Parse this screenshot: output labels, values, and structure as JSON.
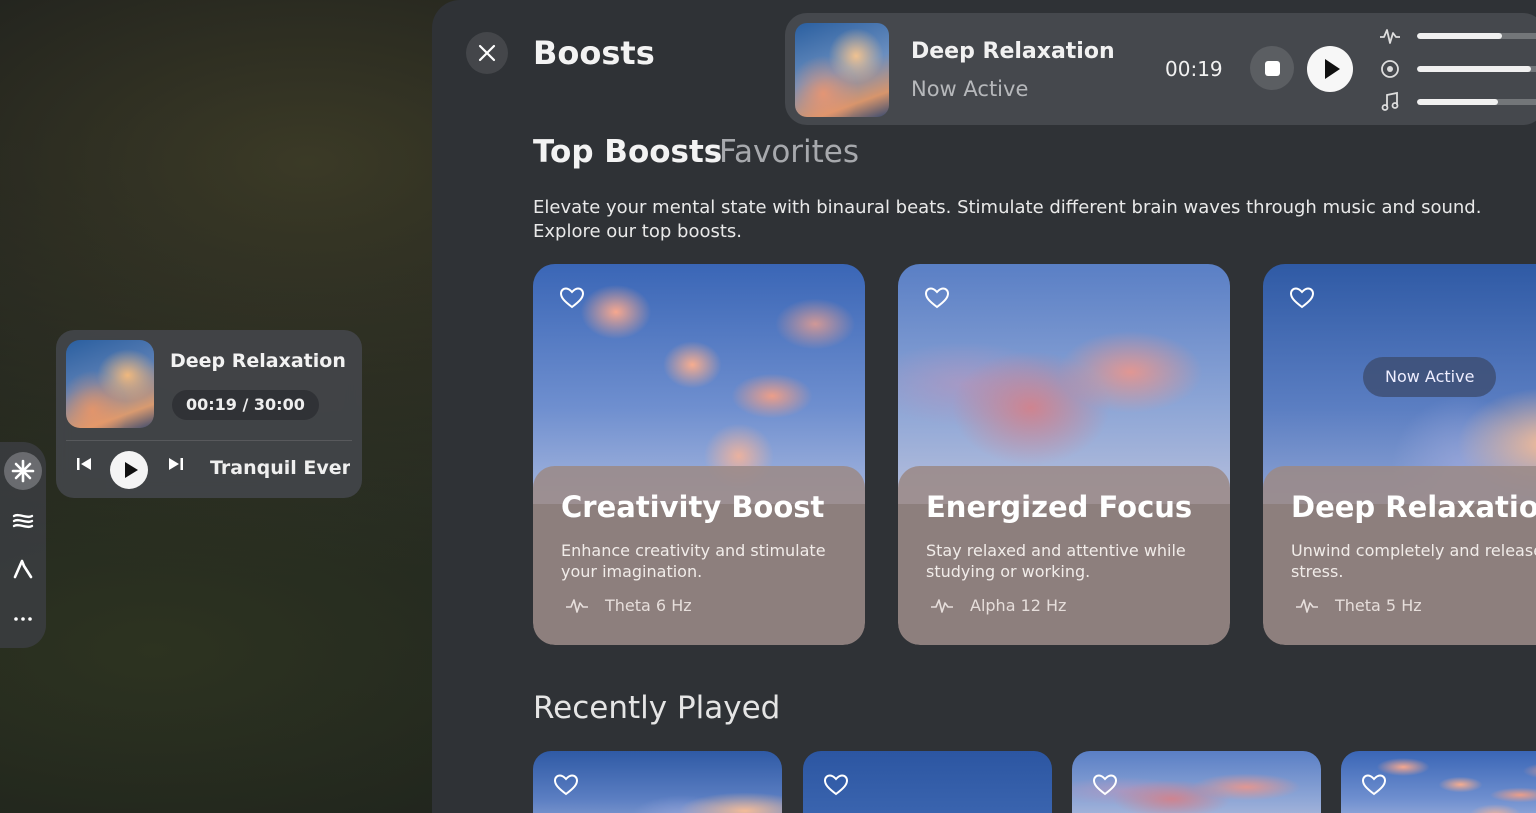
{
  "mini_player": {
    "title": "Deep Relaxation",
    "time": "00:19 / 30:00",
    "next_track": "Tranquil Evenin"
  },
  "toolbar": {
    "icons": [
      "asterisk-icon",
      "waves-icon",
      "compass-icon",
      "more-icon"
    ]
  },
  "header": {
    "title": "Boosts"
  },
  "now_playing": {
    "title": "Deep Relaxation",
    "status": "Now Active",
    "elapsed": "00:19",
    "mixer_levels": [
      0.65,
      0.88,
      0.62
    ]
  },
  "tabs": [
    {
      "label": "Top Boosts",
      "active": true
    },
    {
      "label": "Favorites",
      "active": false
    }
  ],
  "description": "Elevate your mental state with binaural beats. Stimulate different brain waves through music and sound. Explore our top boosts.",
  "cards": [
    {
      "title": "Creativity Boost",
      "desc": "Enhance creativity and stimulate your imagination.",
      "freq": "Theta 6 Hz"
    },
    {
      "title": "Energized Focus",
      "desc": "Stay relaxed and attentive while studying or working.",
      "freq": "Alpha 12 Hz"
    },
    {
      "title": "Deep Relaxation",
      "desc": "Unwind completely and release stress.",
      "freq": "Theta 5 Hz",
      "badge": "Now Active"
    }
  ],
  "recently_played": {
    "title": "Recently Played"
  },
  "colors": {
    "window_bg": "#2f3236",
    "card_info_bg": "#9b8a87",
    "accent_white": "#f7f7f7"
  }
}
